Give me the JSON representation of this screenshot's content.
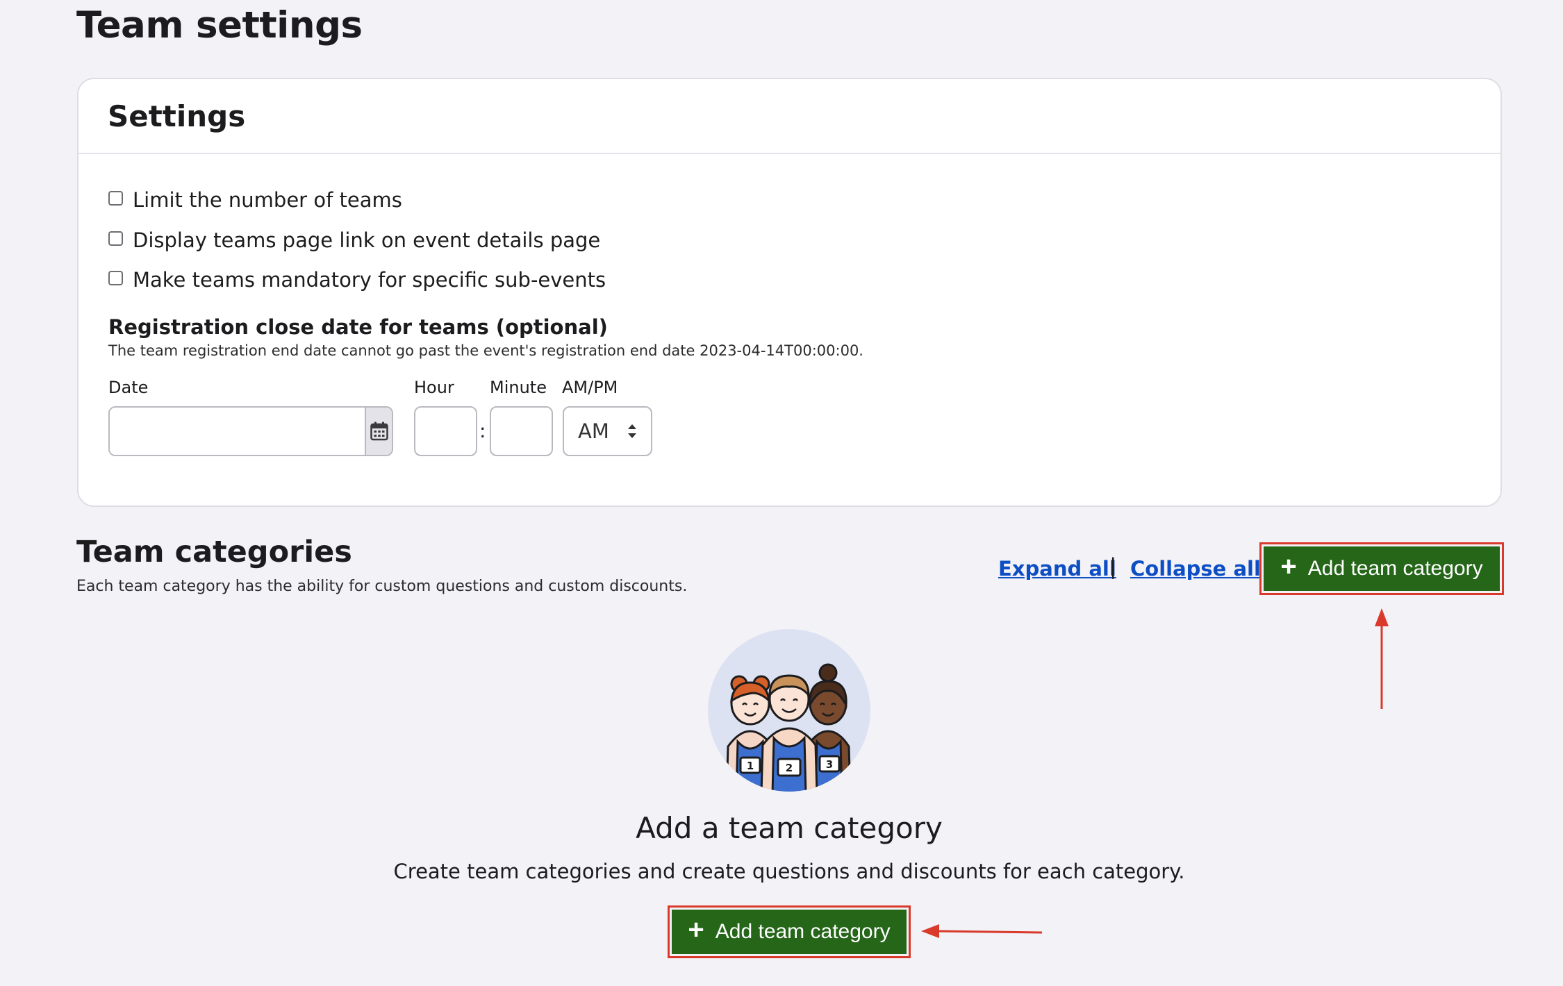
{
  "page": {
    "title": "Team settings"
  },
  "settings": {
    "title": "Settings",
    "checkboxes": [
      {
        "label": "Limit the number of teams",
        "checked": false
      },
      {
        "label": "Display teams page link on event details page",
        "checked": false
      },
      {
        "label": "Make teams mandatory for specific sub-events",
        "checked": false
      }
    ],
    "registration": {
      "title": "Registration close date for teams (optional)",
      "description": "The team registration end date cannot go past the event's registration end date 2023-04-14T00:00:00.",
      "date_label": "Date",
      "date_value": "",
      "hour_label": "Hour",
      "hour_value": "",
      "minute_label": "Minute",
      "minute_value": "",
      "colon": ":",
      "ampm_label": "AM/PM",
      "ampm_value": "AM"
    }
  },
  "team_categories": {
    "title": "Team categories",
    "description": "Each team category has the ability for custom questions and custom discounts.",
    "expand_all": "Expand all",
    "separator": "|",
    "collapse_all": "Collapse all",
    "add_button_label": "Add team category",
    "empty_state": {
      "title": "Add a team category",
      "description": "Create team categories and create questions and discounts for each category.",
      "button_label": "Add team category",
      "bib_numbers": [
        "1",
        "2",
        "3"
      ]
    }
  },
  "colors": {
    "primary_button": "#256619",
    "link": "#0d4ec4",
    "annotation_red": "#d93a2b",
    "background": "#f2f2f7"
  },
  "icons": [
    "calendar-icon",
    "sort-arrows-icon",
    "plus-icon"
  ]
}
